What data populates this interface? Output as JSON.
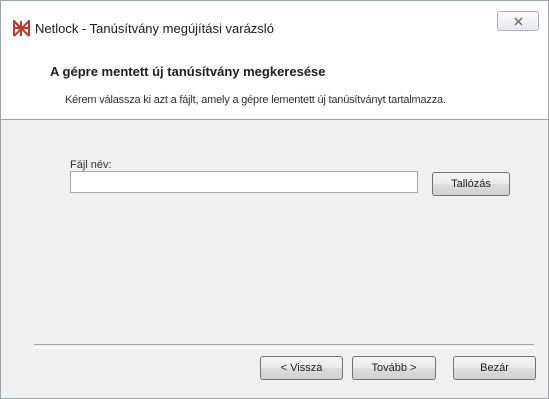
{
  "window": {
    "title": "Netlock - Tanúsítvány megújítási varázsló",
    "icon": "netlock-logo-icon",
    "close_icon": "close-icon"
  },
  "header": {
    "title": "A gépre mentett új tanúsítvány megkeresése",
    "description": "Kérem válassza ki azt a fájlt, amely a gépre lementett új tanúsítványt tartalmazza."
  },
  "form": {
    "file_label": "Fájl név:",
    "file_value": "",
    "browse_label": "Tallózás"
  },
  "footer": {
    "back_label": "< Vissza",
    "next_label": "Tovább >",
    "close_label": "Bezár"
  },
  "colors": {
    "window_background": "#f0f0f0",
    "panel_background": "#ffffff",
    "logo_color": "#c0392b"
  }
}
